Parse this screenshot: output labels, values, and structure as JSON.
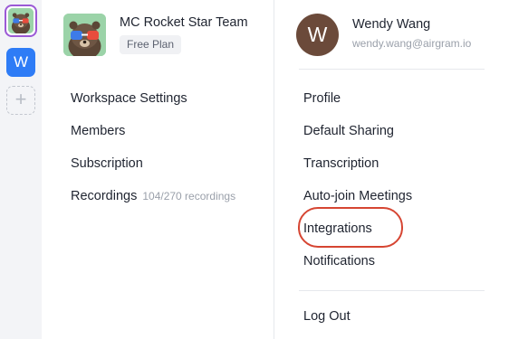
{
  "rail": {
    "workspace_w_letter": "W",
    "add_symbol": "+",
    "active_workspace_icon": "otter-mascot-icon"
  },
  "team": {
    "name": "MC Rocket Star Team",
    "plan": "Free Plan",
    "avatar_icon": "otter-mascot-icon"
  },
  "workspace_menu": {
    "settings": "Workspace Settings",
    "members": "Members",
    "subscription": "Subscription",
    "recordings": "Recordings",
    "recordings_count": "104/270 recordings"
  },
  "user": {
    "initial": "W",
    "name": "Wendy Wang",
    "email": "wendy.wang@airgram.io"
  },
  "user_menu": {
    "profile": "Profile",
    "default_sharing": "Default Sharing",
    "transcription": "Transcription",
    "auto_join": "Auto-join Meetings",
    "integrations": "Integrations",
    "notifications": "Notifications",
    "logout": "Log Out"
  },
  "colors": {
    "accent_purple": "#9b59d6",
    "workspace_blue": "#2e7cf6",
    "highlight_red": "#d64532",
    "user_avatar_brown": "#6b4a3a"
  }
}
